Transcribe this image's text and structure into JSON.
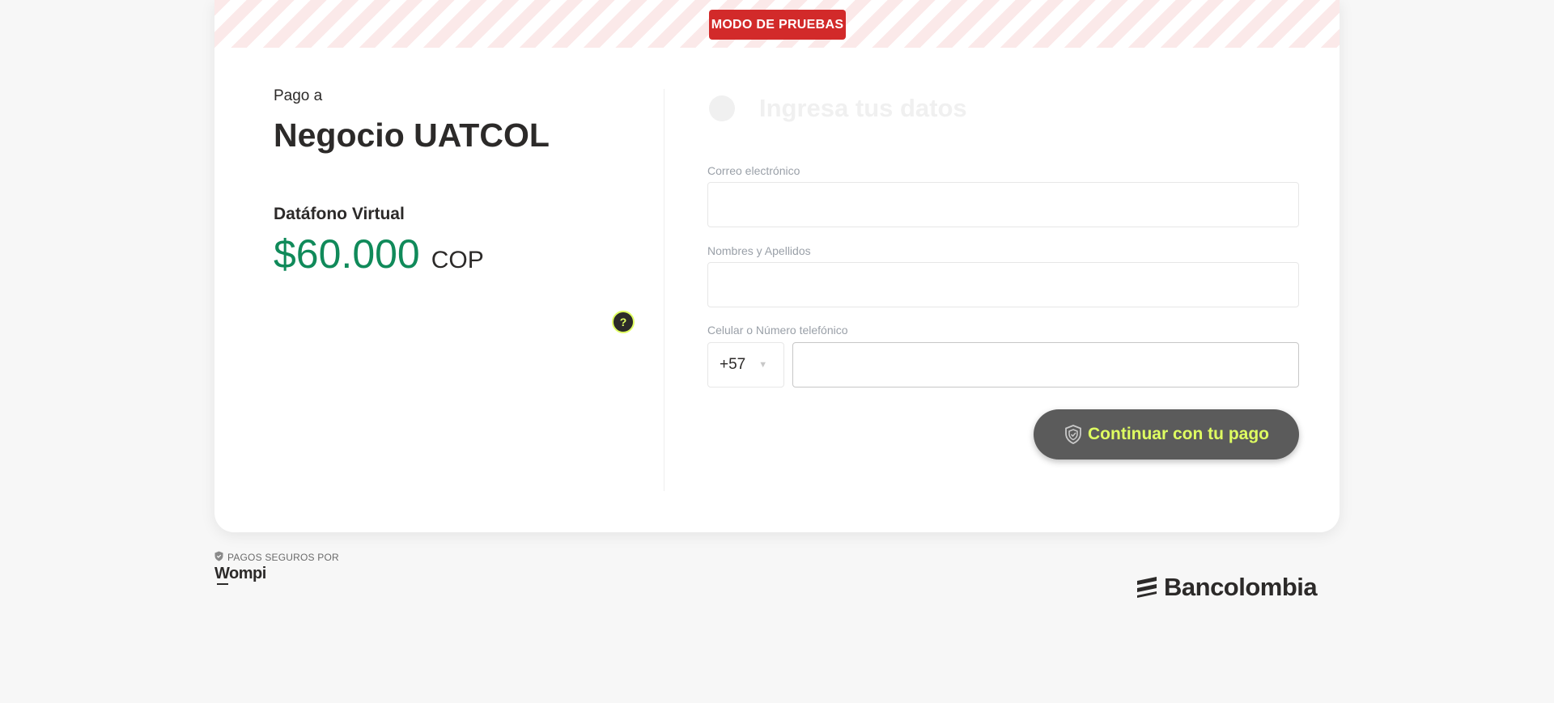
{
  "banner": {
    "label": "MODO DE PRUEBAS"
  },
  "summary": {
    "pay_to_label": "Pago a",
    "merchant_name": "Negocio UATCOL",
    "product_name": "Datáfono Virtual",
    "amount": "$60.000",
    "currency": "COP",
    "help_glyph": "?"
  },
  "form": {
    "step_title": "Ingresa tus datos",
    "email": {
      "label": "Correo electrónico",
      "value": "",
      "placeholder": ""
    },
    "name": {
      "label": "Nombres y Apellidos",
      "value": "",
      "placeholder": ""
    },
    "phone": {
      "label": "Celular o Número telefónico",
      "prefix": "+57",
      "value": "",
      "placeholder": ""
    },
    "continue_label": "Continuar con tu pago"
  },
  "footer": {
    "secure_label": "PAGOS SEGUROS POR",
    "provider_logo": "Wompi",
    "bank_logo": "Bancolombia"
  },
  "colors": {
    "amount": "#108a5a",
    "badge": "#d22a2a",
    "accent": "#dfff61",
    "button": "#5b5b5b"
  },
  "icons": {
    "help": "help-icon",
    "shield": "shield-icon",
    "chevron": "chevron-down-icon"
  }
}
